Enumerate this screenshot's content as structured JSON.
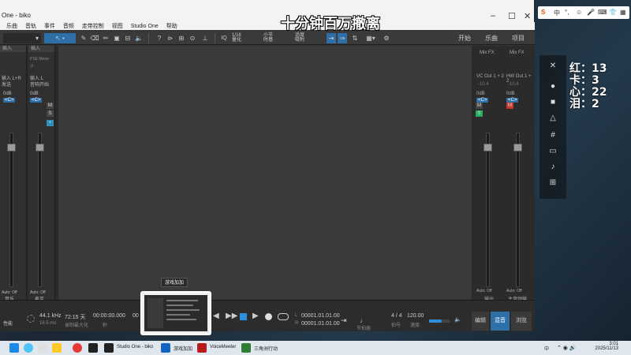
{
  "window": {
    "title": "One - biko",
    "minimize": "–",
    "maximize": "☐",
    "close": "✕"
  },
  "menu": [
    "乐曲",
    "音轨",
    "事件",
    "音频",
    "走带控制",
    "视图",
    "Studio One",
    "帮助"
  ],
  "toolbar": {
    "quantize": "1/16",
    "quantize_label": "量化",
    "timebase": "小节",
    "timebase_label": "时基",
    "snap": "适度",
    "snap_label": "吸附",
    "start_tab": "开始",
    "song_tab": "乐曲",
    "project_tab": "项目"
  },
  "inspector": {
    "header": "插入",
    "strip1": {
      "input": "输入 L+R",
      "send": "发送",
      "level": "0dB",
      "pan": "<C>",
      "name": "音乐",
      "mode": "Auto: Off"
    },
    "strip2": {
      "header": "插入",
      "slot1": "PSE Meter",
      "slot2": "小",
      "input": "输入 L",
      "insert_label": "插件",
      "level": "0dB",
      "pan": "<C>",
      "name": "麦克",
      "mode": "Auto: Off",
      "device": "音响开始"
    }
  },
  "mixer": {
    "fx1": "Mix FX",
    "fx2": "Mix FX",
    "out1": "VC Out 1 + 2",
    "out2": "HW Out 1 + 2",
    "db1": "-10.4",
    "db2": "-10.4",
    "lvl1": "0dB",
    "lvl2": "0dB",
    "pan1": "<C>",
    "pan2": "<C>",
    "name1": "输出",
    "name2": "主音频输",
    "mode1": "Auto: Off",
    "mode2": "Auto: Off",
    "edit": "编辑",
    "mix": "混音",
    "browse": "浏览"
  },
  "transport": {
    "perf": "性能",
    "sample_rate": "44.1 kHz",
    "latency": "16.5 ms",
    "days": "72:15 天",
    "record_max": "录制最大化",
    "time": "00:00:00.000",
    "sec": "秒",
    "bars_label": "00",
    "pos_l": "00001.01.01.00",
    "pos_r": "00001.01.01.00",
    "sig": "4 / 4",
    "sig_label": "节拍器",
    "sig_label2": "拍号",
    "tempo": "120.00",
    "tempo_label": "速度"
  },
  "overlay": {
    "title": "十分钟百万撤离",
    "stats": [
      "红：13",
      "卡：3",
      "心：22",
      "泪：2"
    ]
  },
  "ime": {
    "logo": "S",
    "lang": "中",
    "punct": "°,",
    "extras": [
      "☺",
      "🎤",
      "⌨",
      "👕",
      "▦"
    ]
  },
  "preview": {
    "tooltip": "游戏加加"
  },
  "taskbar": {
    "apps": [
      {
        "label": "Studio One - biko"
      },
      {
        "label": "游戏加加"
      },
      {
        "label": "VoiceMeeter"
      },
      {
        "label": "三角洲行动"
      }
    ],
    "time": "3:01",
    "date": "2025/11/13",
    "tray_lang": "中"
  },
  "colors": {
    "accent": "#2f6fa8",
    "mute_red": "#c0392b",
    "solo_green": "#27ae60"
  }
}
